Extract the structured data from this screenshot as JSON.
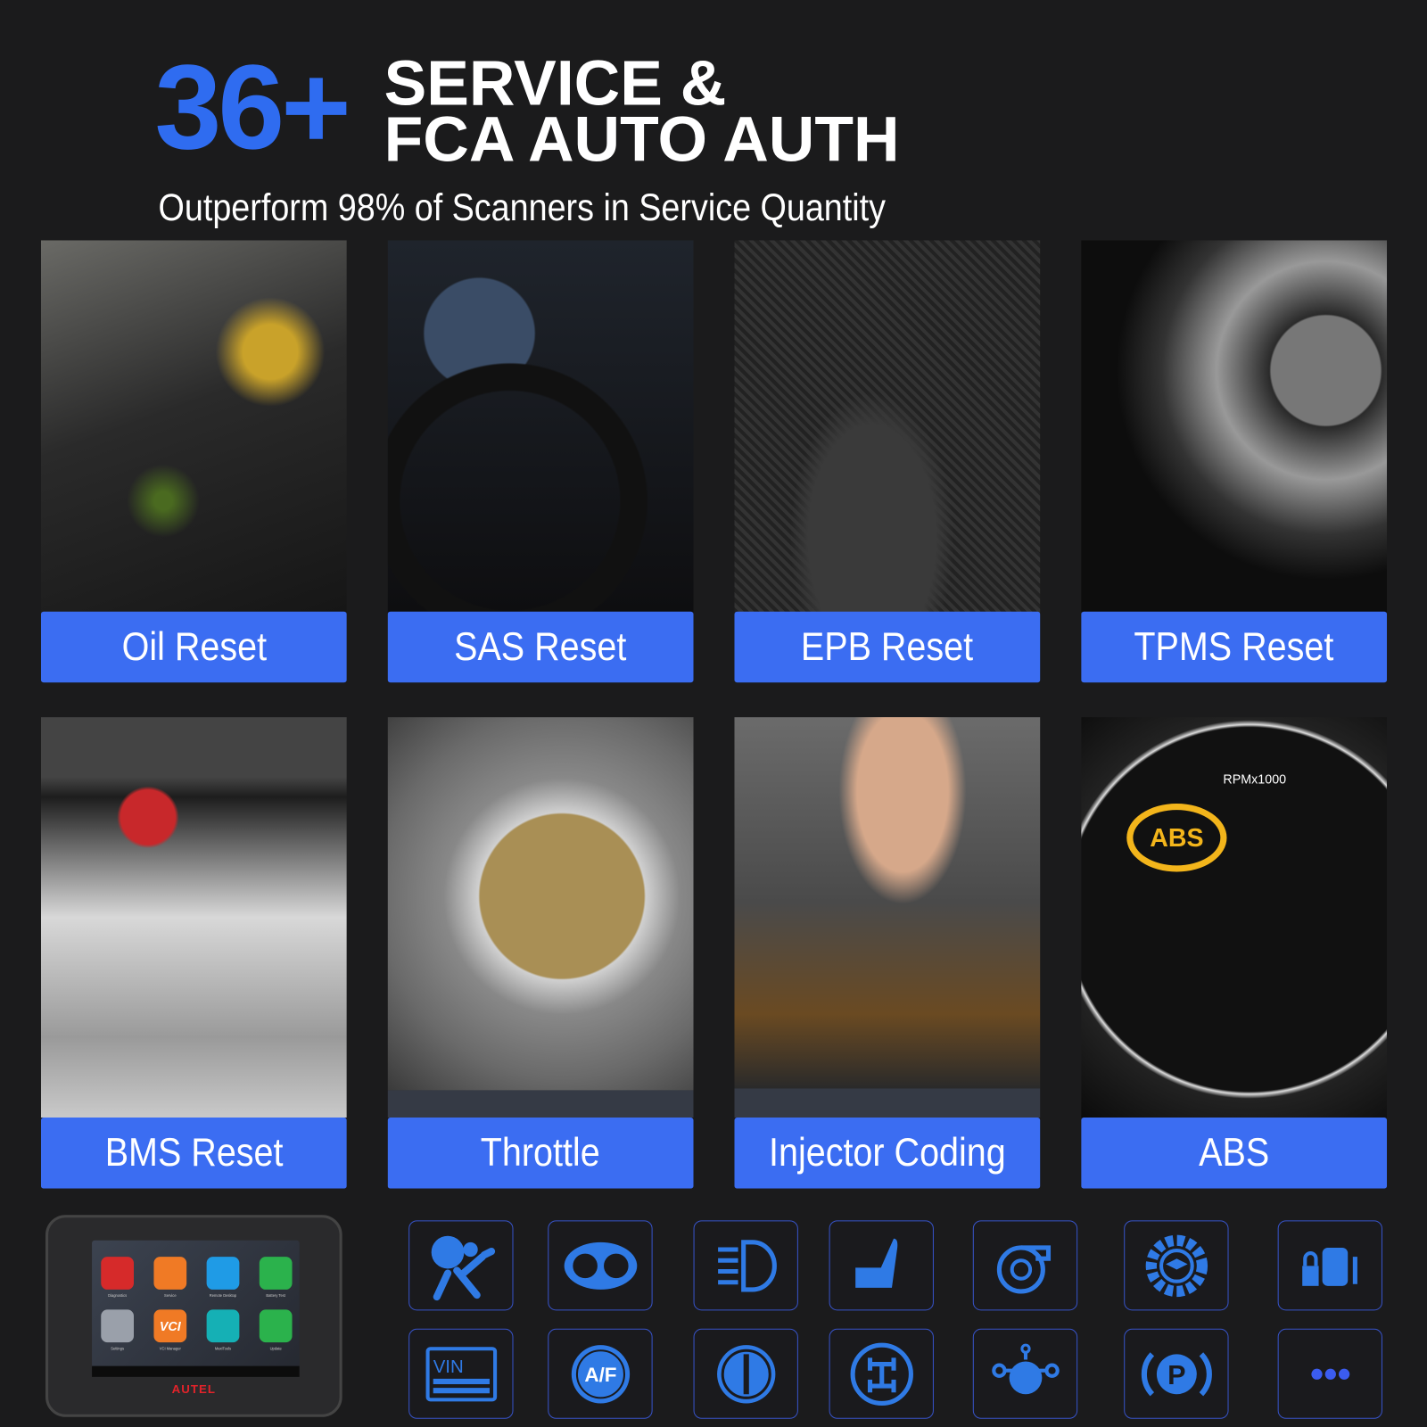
{
  "header": {
    "count": "36+",
    "title_line1": "SERVICE &",
    "title_line2": "FCA AUTO AUTH",
    "subtitle": "Outperform 98% of Scanners in Service Quantity"
  },
  "services": [
    {
      "label": "Oil Reset",
      "image": "engine oil pouring"
    },
    {
      "label": "SAS Reset",
      "image": "steering wheel"
    },
    {
      "label": "EPB Reset",
      "image": "electronic parking brake switch"
    },
    {
      "label": "TPMS Reset",
      "image": "tire and wheel"
    },
    {
      "label": "BMS Reset",
      "image": "car battery"
    },
    {
      "label": "Throttle",
      "image": "throttle body"
    },
    {
      "label": "Injector Coding",
      "image": "fuel injector"
    },
    {
      "label": "ABS",
      "image": "dashboard ABS warning"
    }
  ],
  "gauge_text": {
    "rpm": "RPMx1000",
    "abs": "ABS"
  },
  "icons_row1": [
    "airbag-icon",
    "instrument-cluster-icon",
    "headlight-icon",
    "seat-icon",
    "turbo-icon",
    "gear-learning-icon",
    "engine-lock-icon"
  ],
  "icons_row2": [
    "vin-icon",
    "air-fuel-icon",
    "suspension-icon",
    "transfer-case-icon",
    "gearbox-icon",
    "parking-brake-icon",
    "more-icon"
  ],
  "icon_text": {
    "vin": "VIN",
    "af": "A/F",
    "p": "P"
  },
  "tablet": {
    "brand": "AUTEL",
    "apps": [
      "Diagnostics",
      "Service",
      "Remote Desktop",
      "Battery Test",
      "Settings",
      "VCI Manager",
      "MaxiTools",
      "Update"
    ],
    "vci": "VCI"
  },
  "colors": {
    "accent": "#3b6df2",
    "icon": "#2f7ae5",
    "background": "#1b1b1c",
    "brand_red": "#e2232a"
  }
}
